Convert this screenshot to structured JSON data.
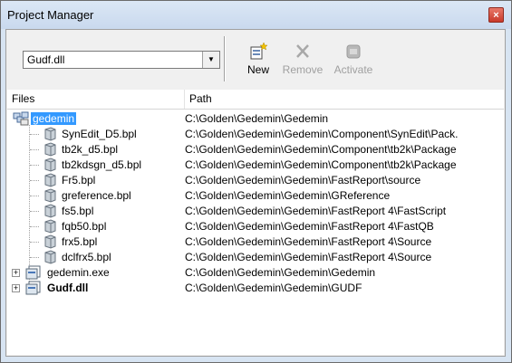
{
  "window": {
    "title": "Project Manager",
    "close_label": "×"
  },
  "toolbar": {
    "project_select_value": "Gudf.dll",
    "new_label": "New",
    "remove_label": "Remove",
    "activate_label": "Activate"
  },
  "columns": {
    "files": "Files",
    "path": "Path"
  },
  "rows": [
    {
      "name": "gedemin",
      "path": "C:\\Golden\\Gedemin\\Gedemin"
    },
    {
      "name": "SynEdit_D5.bpl",
      "path": "C:\\Golden\\Gedemin\\Gedemin\\Component\\SynEdit\\Pack."
    },
    {
      "name": "tb2k_d5.bpl",
      "path": "C:\\Golden\\Gedemin\\Gedemin\\Component\\tb2k\\Package"
    },
    {
      "name": "tb2kdsgn_d5.bpl",
      "path": "C:\\Golden\\Gedemin\\Gedemin\\Component\\tb2k\\Package"
    },
    {
      "name": "Fr5.bpl",
      "path": "C:\\Golden\\Gedemin\\Gedemin\\FastReport\\source"
    },
    {
      "name": "greference.bpl",
      "path": "C:\\Golden\\Gedemin\\Gedemin\\GReference"
    },
    {
      "name": "fs5.bpl",
      "path": "C:\\Golden\\Gedemin\\Gedemin\\FastReport 4\\FastScript"
    },
    {
      "name": "fqb50.bpl",
      "path": "C:\\Golden\\Gedemin\\Gedemin\\FastReport 4\\FastQB"
    },
    {
      "name": "frx5.bpl",
      "path": "C:\\Golden\\Gedemin\\Gedemin\\FastReport 4\\Source"
    },
    {
      "name": "dclfrx5.bpl",
      "path": "C:\\Golden\\Gedemin\\Gedemin\\FastReport 4\\Source"
    },
    {
      "name": "gedemin.exe",
      "path": "C:\\Golden\\Gedemin\\Gedemin\\Gedemin"
    },
    {
      "name": "Gudf.dll",
      "path": "C:\\Golden\\Gedemin\\Gedemin\\GUDF"
    }
  ],
  "icons": {
    "group": "project-group-icon",
    "package": "package-icon",
    "project": "project-icon",
    "expander": "+"
  }
}
